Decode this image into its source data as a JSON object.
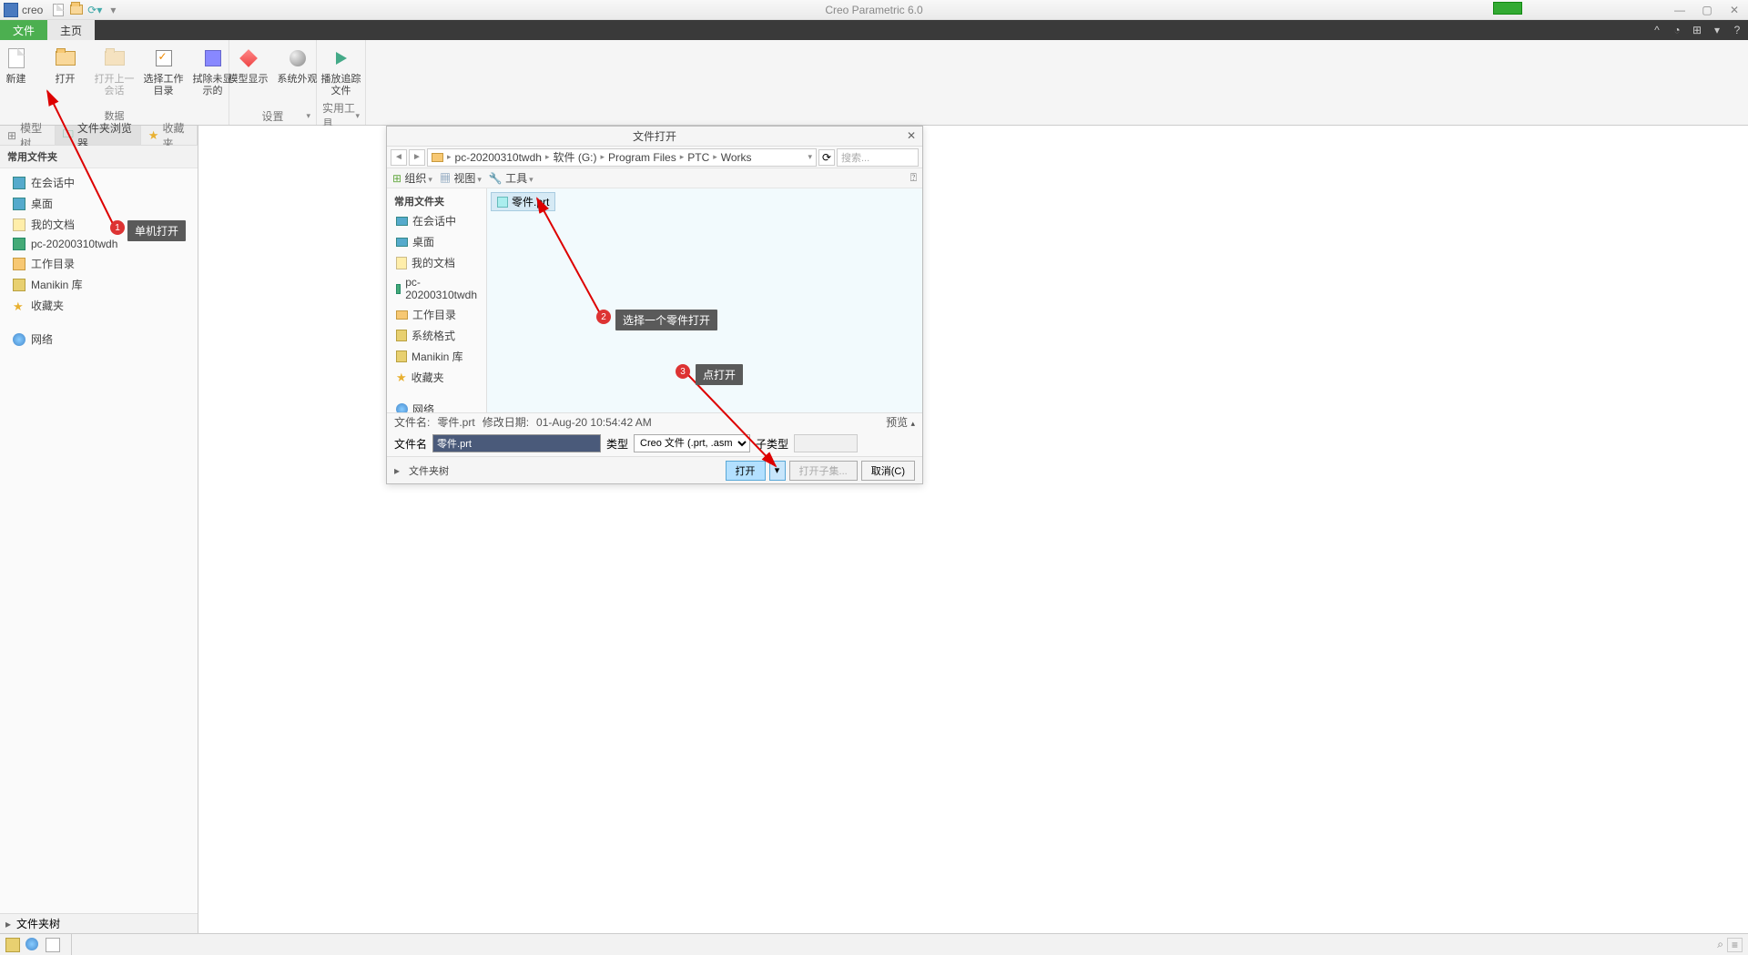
{
  "app": {
    "name": "creo",
    "title": "Creo Parametric 6.0"
  },
  "ribbon": {
    "tabs": {
      "file": "文件",
      "home": "主页"
    },
    "groups": {
      "data": {
        "name": "数据",
        "new": "新建",
        "open": "打开",
        "open_prev": "打开上一会话",
        "select_dir": "选择工作目录",
        "erase": "拭除未显示的"
      },
      "settings": {
        "name": "设置",
        "model_disp": "模型显示",
        "sys_appear": "系统外观"
      },
      "util": {
        "name": "实用工具",
        "play": "播放追踪文件"
      }
    }
  },
  "panel": {
    "tabs": {
      "model_tree": "模型树",
      "folder_browser": "文件夹浏览器",
      "favorites": "收藏夹"
    },
    "sec_title": "常用文件夹",
    "items": {
      "session": "在会话中",
      "desktop": "桌面",
      "documents": "我的文档",
      "pc": "pc-20200310twdh",
      "workdir": "工作目录",
      "manikin": "Manikin 库",
      "favorites": "收藏夹",
      "network": "网络"
    },
    "folder_tree": "文件夹树"
  },
  "dialog": {
    "title": "文件打开",
    "breadcrumb": [
      "pc-20200310twdh",
      "软件 (G:)",
      "Program Files",
      "PTC",
      "Works"
    ],
    "search_ph": "搜索...",
    "toolbar": {
      "organize": "组织",
      "views": "视图",
      "tools": "工具"
    },
    "nav_title": "常用文件夹",
    "nav": {
      "session": "在会话中",
      "desktop": "桌面",
      "documents": "我的文档",
      "pc": "pc-20200310twdh",
      "workdir": "工作目录",
      "sysfmt": "系统格式",
      "manikin": "Manikin 库",
      "favorites": "收藏夹",
      "network": "网络"
    },
    "file": "零件.prt",
    "status": {
      "fname_lbl": "文件名:",
      "fname_val": "零件.prt",
      "mdate_lbl": "修改日期:",
      "mdate_val": "01-Aug-20 10:54:42 AM",
      "preview": "预览"
    },
    "row2": {
      "fname_lbl": "文件名",
      "fname_val": "零件.prt",
      "type_lbl": "类型",
      "type_val": "Creo 文件 (.prt, .asm,",
      "subtype_lbl": "子类型"
    },
    "footer": {
      "folder_tree": "文件夹树",
      "open": "打开",
      "open_subset": "打开子集...",
      "cancel": "取消(C)"
    }
  },
  "callouts": {
    "c1": "单机打开",
    "c2": "选择一个零件打开",
    "c3": "点打开"
  }
}
